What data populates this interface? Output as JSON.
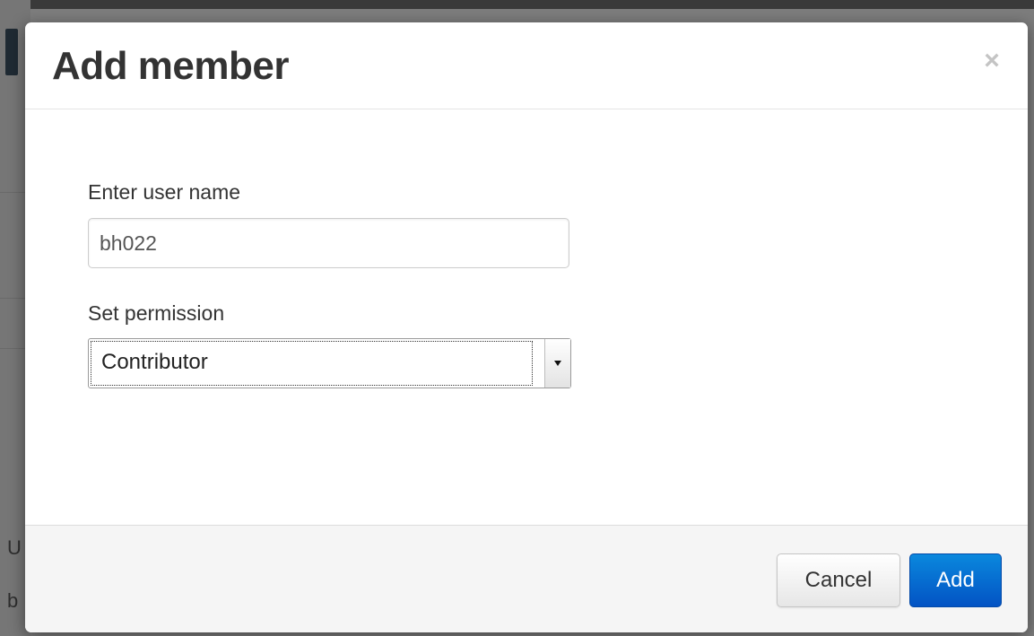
{
  "modal": {
    "title": "Add member",
    "close_glyph": "×",
    "username": {
      "label": "Enter user name",
      "value": "bh022"
    },
    "permission": {
      "label": "Set permission",
      "selected": "Contributor"
    },
    "footer": {
      "cancel_label": "Cancel",
      "add_label": "Add"
    }
  },
  "background": {
    "partial_chars": [
      "U",
      "b"
    ]
  },
  "colors": {
    "primary_button": "#0a72d6",
    "title_text": "#333333",
    "footer_bg": "#f5f5f5"
  },
  "icons": {
    "close": "close-icon",
    "select_arrow": "chevron-down-icon"
  }
}
